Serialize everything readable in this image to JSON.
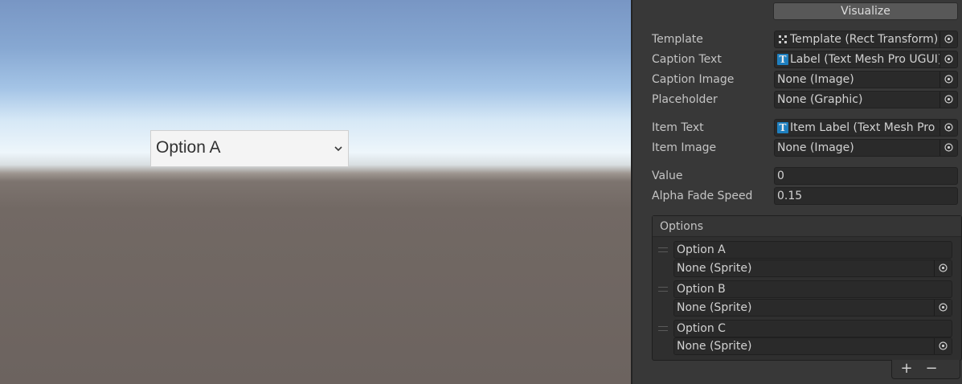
{
  "scene": {
    "dropdown": {
      "selected_label": "Option A",
      "arrow_icon": "chevron-down-icon"
    }
  },
  "inspector": {
    "visualize_label": "Visualize",
    "template": {
      "label": "Template",
      "value": "Template (Rect Transform)",
      "icon": "rect-transform-icon"
    },
    "caption_text": {
      "label": "Caption Text",
      "value": "Label (Text Mesh Pro UGUI)",
      "icon": "textmeshpro-icon",
      "icon_glyph": "T"
    },
    "caption_image": {
      "label": "Caption Image",
      "value": "None (Image)"
    },
    "placeholder": {
      "label": "Placeholder",
      "value": "None (Graphic)"
    },
    "item_text": {
      "label": "Item Text",
      "value": "Item Label (Text Mesh Pro UGUI)",
      "icon": "textmeshpro-icon",
      "icon_glyph": "T"
    },
    "item_image": {
      "label": "Item Image",
      "value": "None (Image)"
    },
    "value": {
      "label": "Value",
      "value": "0"
    },
    "alpha_fade_speed": {
      "label": "Alpha Fade Speed",
      "value": "0.15"
    },
    "options": {
      "title": "Options",
      "items": [
        {
          "text": "Option A",
          "image": "None (Sprite)"
        },
        {
          "text": "Option B",
          "image": "None (Sprite)"
        },
        {
          "text": "Option C",
          "image": "None (Sprite)"
        }
      ],
      "add_label": "+",
      "remove_label": "−"
    }
  },
  "colors": {
    "inspector_bg": "#383838",
    "field_bg": "#2a2a2a",
    "text": "#c4c4c4",
    "tmp_icon": "#1e7fbf"
  }
}
